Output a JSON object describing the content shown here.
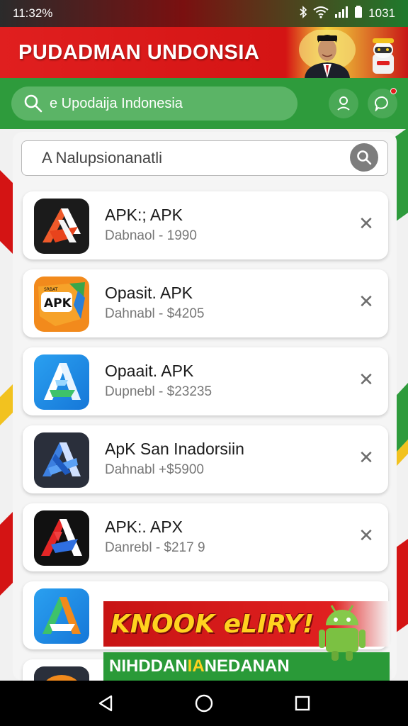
{
  "status_bar": {
    "time": "11:32%",
    "clock_right": "1031",
    "icons": [
      "bluetooth-icon",
      "wifi-icon",
      "signal-icon",
      "battery-icon"
    ]
  },
  "banner": {
    "title": "PUDADMAN UNDONSIA"
  },
  "search": {
    "text": "е Upodaija Indonesia"
  },
  "filter": {
    "value": "A Nalupsionanatli"
  },
  "apps": [
    {
      "name": "APK:; APK",
      "sub": "Dabnaol - 1990",
      "icon": "apk-red-icon"
    },
    {
      "name": "Opasit. APK",
      "sub": "Dahnabl - $4205",
      "icon": "apk-orange-icon"
    },
    {
      "name": "Opaait. APK",
      "sub": "Dupnebl - $23235",
      "icon": "apk-blue-icon"
    },
    {
      "name": "ApK San Inadorsiin",
      "sub": "Dahnabl +$5900",
      "icon": "apk-dark-blue-icon"
    },
    {
      "name": "APK:. APX",
      "sub": "Danrebl - $217 9",
      "icon": "apk-black-red-icon"
    },
    {
      "name": "",
      "sub": "",
      "icon": "apk-multicolor-icon"
    }
  ],
  "promo": {
    "title": "KNOOK eLIRY!",
    "subtitle_a": "NIHDDAN",
    "subtitle_b": "IA",
    "subtitle_c": " NEDANAN"
  },
  "colors": {
    "green": "#2e9b3c",
    "red": "#d41414",
    "yellow": "#ffd21f"
  }
}
